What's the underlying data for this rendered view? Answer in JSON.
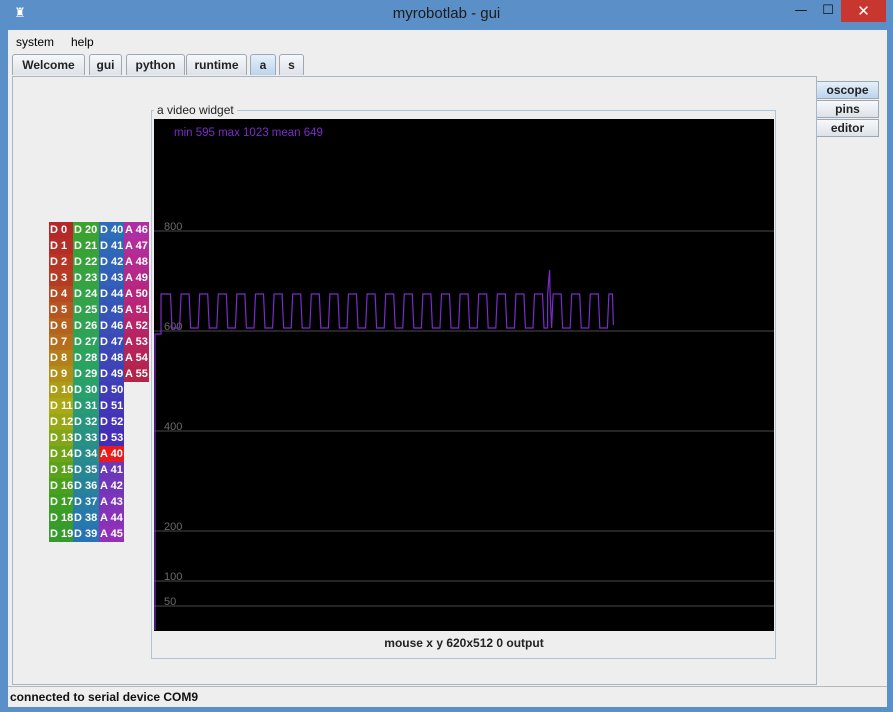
{
  "window": {
    "title": "myrobotlab - gui",
    "icon": "robot-icon",
    "minimize_glyph": "—",
    "maximize_glyph": "☐",
    "close_glyph": "✕"
  },
  "menu": [
    {
      "label": "system"
    },
    {
      "label": "help"
    }
  ],
  "tabs": [
    {
      "label": "Welcome",
      "active": false
    },
    {
      "label": "gui",
      "active": false
    },
    {
      "label": "python",
      "active": false
    },
    {
      "label": "runtime",
      "active": false
    },
    {
      "label": "a",
      "active": true
    },
    {
      "label": "s",
      "active": false
    }
  ],
  "side_tabs": [
    {
      "label": "oscope",
      "active": true
    },
    {
      "label": "pins",
      "active": false
    },
    {
      "label": "editor",
      "active": false
    }
  ],
  "video_widget": {
    "title": "a  video widget",
    "stats": "min 595 max 1023 mean 649",
    "mouse_status": "mouse x y  620x512  0  output",
    "grid_labels": [
      "800",
      "600",
      "400",
      "200",
      "100",
      "50"
    ],
    "signal_color": "#7a2cc8"
  },
  "pin_columns": [
    {
      "labels": [
        "D 0",
        "D 1",
        "D 2",
        "D 3",
        "D 4",
        "D 5",
        "D 6",
        "D 7",
        "D 8",
        "D 9",
        "D 10",
        "D 11",
        "D 12",
        "D 13",
        "D 14",
        "D 15",
        "D 16",
        "D 17",
        "D 18",
        "D 19"
      ],
      "colors": [
        "#b5282a",
        "#b62d28",
        "#b83526",
        "#b43c24",
        "#b54a22",
        "#b55520",
        "#b5621e",
        "#b56f1c",
        "#b37f1a",
        "#b08e18",
        "#ac9d16",
        "#a8a914",
        "#96a816",
        "#82a618",
        "#6ea41a",
        "#5aa21c",
        "#4aa01e",
        "#3f9e22",
        "#3a9c28",
        "#379a2e"
      ]
    },
    {
      "labels": [
        "D 20",
        "D 21",
        "D 22",
        "D 23",
        "D 24",
        "D 25",
        "D 26",
        "D 27",
        "D 28",
        "D 29",
        "D 30",
        "D 31",
        "D 32",
        "D 33",
        "D 34",
        "D 35",
        "D 36",
        "D 37",
        "D 38",
        "D 39"
      ],
      "colors": [
        "#3aa32e",
        "#38a334",
        "#36a33a",
        "#34a340",
        "#32a346",
        "#30a34c",
        "#2ea352",
        "#2ca358",
        "#2aa35e",
        "#28a364",
        "#27a06c",
        "#279b74",
        "#27967c",
        "#279184",
        "#278c8c",
        "#278794",
        "#27829c",
        "#277da4",
        "#2778ac",
        "#2773b4"
      ]
    },
    {
      "labels": [
        "D 40",
        "D 41",
        "D 42",
        "D 43",
        "D 44",
        "D 45",
        "D 46",
        "D 47",
        "D 48",
        "D 49",
        "D 50",
        "D 51",
        "D 52",
        "D 53",
        "A 40",
        "A 41",
        "A 42",
        "A 43",
        "A 44",
        "A 45"
      ],
      "colors": [
        "#2c6eb8",
        "#2e69b8",
        "#3064b8",
        "#325fb8",
        "#345ab8",
        "#3655b8",
        "#3850b8",
        "#3a4bb8",
        "#3c46b8",
        "#3e41b8",
        "#403cb8",
        "#4237b8",
        "#4432b8",
        "#462db8",
        "#e81c1c",
        "#6a38b8",
        "#7436b8",
        "#7e34b8",
        "#8832b8",
        "#9230b8"
      ]
    },
    {
      "labels": [
        "A 46",
        "A 47",
        "A 48",
        "A 49",
        "A 50",
        "A 51",
        "A 52",
        "A 53",
        "A 54",
        "A 55"
      ],
      "colors": [
        "#b02ea4",
        "#b22c9a",
        "#b42a90",
        "#b62886",
        "#b8267c",
        "#ba2472",
        "#b82468",
        "#b6245e",
        "#b42454",
        "#b2244a"
      ]
    }
  ],
  "status_bar": {
    "text": "connected to serial device COM9"
  }
}
